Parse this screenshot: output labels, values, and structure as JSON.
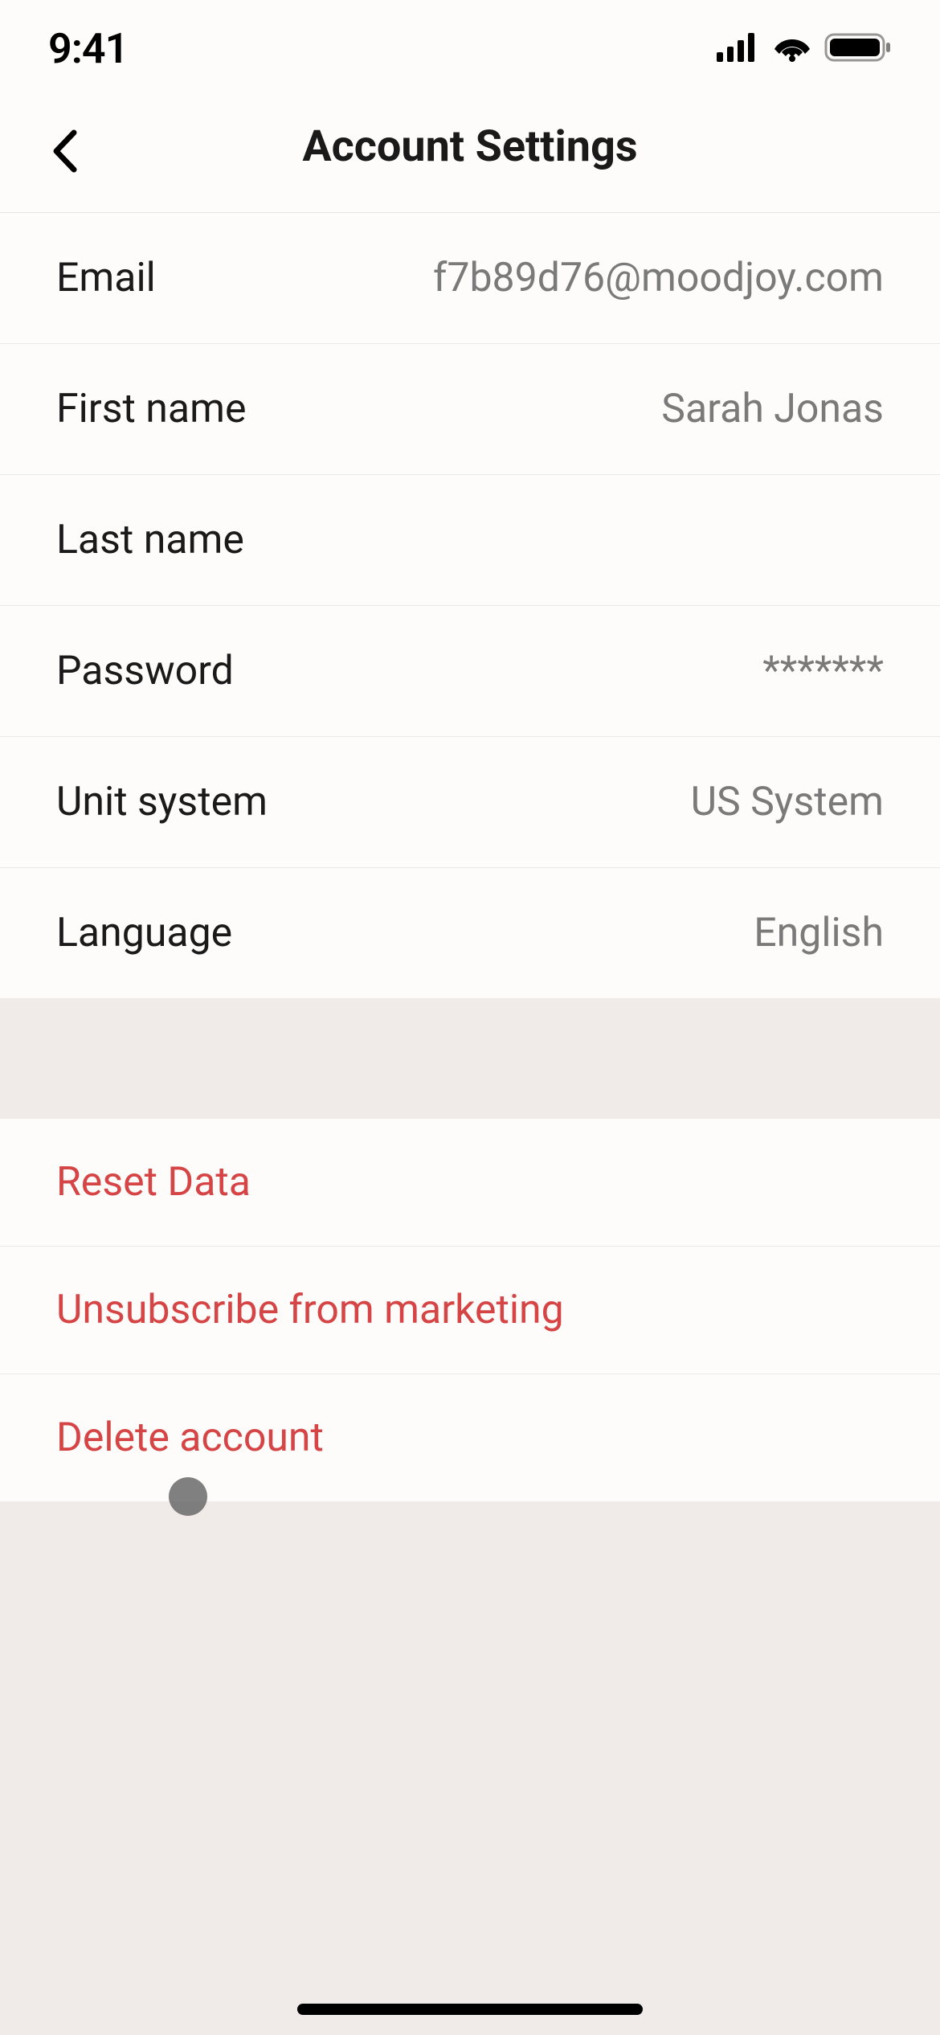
{
  "statusBar": {
    "time": "9:41"
  },
  "nav": {
    "title": "Account Settings"
  },
  "settings": {
    "email": {
      "label": "Email",
      "value": "f7b89d76@moodjoy.com"
    },
    "firstName": {
      "label": "First name",
      "value": "Sarah Jonas"
    },
    "lastName": {
      "label": "Last name",
      "value": ""
    },
    "password": {
      "label": "Password",
      "value": "*******"
    },
    "unitSystem": {
      "label": "Unit system",
      "value": "US System"
    },
    "language": {
      "label": "Language",
      "value": "English"
    }
  },
  "actions": {
    "resetData": "Reset Data",
    "unsubscribe": "Unsubscribe from marketing",
    "deleteAccount": "Delete account"
  }
}
